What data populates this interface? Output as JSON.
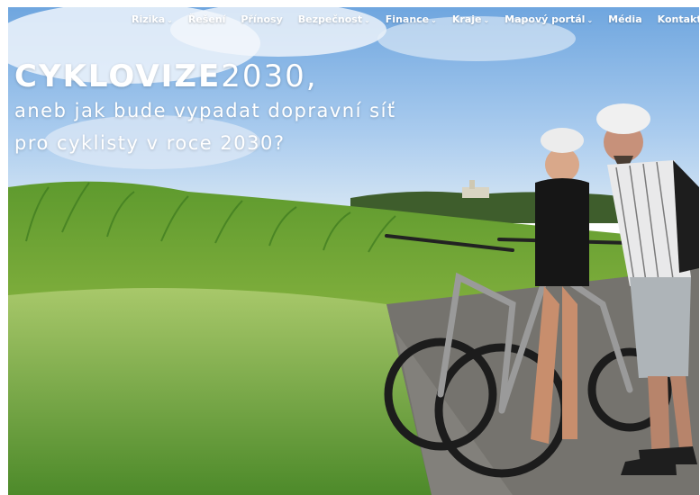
{
  "nav": {
    "items": [
      {
        "label": "Rizika",
        "chevron": "⌄"
      },
      {
        "label": "Řešení",
        "chevron": ""
      },
      {
        "label": "Přínosy",
        "chevron": ""
      },
      {
        "label": "Bezpečnost",
        "chevron": "⌄"
      },
      {
        "label": "Finance",
        "chevron": "⌄"
      },
      {
        "label": "Kraje",
        "chevron": "⌄"
      },
      {
        "label": "Mapový portál",
        "chevron": "⌄"
      },
      {
        "label": "Média",
        "chevron": ""
      },
      {
        "label": "Kontakt",
        "chevron": ""
      }
    ]
  },
  "hero": {
    "title_bold": "CYKLOVIZE",
    "title_light": "2030,",
    "subtitle_line1": "aneb jak bude vypadat dopravní síť",
    "subtitle_line2": "pro cyklisty v roce 2030?"
  },
  "colors": {
    "sky_top": "#7fb2e4",
    "sky_bottom": "#c9def2",
    "field_dark": "#2f6b1c",
    "field_light": "#8dbb48",
    "road": "#6e6c68",
    "text": "#ffffff"
  }
}
